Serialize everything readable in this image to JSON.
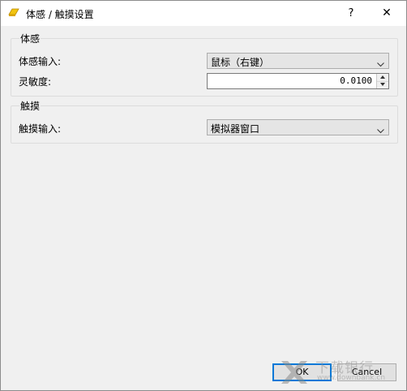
{
  "window": {
    "title": "体感 / 触摸设置",
    "help_label": "?",
    "close_label": "✕"
  },
  "motion_group": {
    "title": "体感",
    "input_label": "体感输入:",
    "input_value": "鼠标（右键）",
    "sensitivity_label": "灵敏度:",
    "sensitivity_value": "0.0100"
  },
  "touch_group": {
    "title": "触摸",
    "input_label": "触摸输入:",
    "input_value": "模拟器窗口"
  },
  "buttons": {
    "ok": "OK",
    "cancel": "Cancel"
  },
  "watermark": {
    "text": "下载银行",
    "url": "www.downbank.cn"
  },
  "colors": {
    "focus_border": "#0078d7",
    "window_bg": "#f0f0f0"
  },
  "icons": {
    "app": "app-logo-icon",
    "dropdown": "chevron-down-icon",
    "spin_up": "spin-up-icon",
    "spin_down": "spin-down-icon"
  }
}
